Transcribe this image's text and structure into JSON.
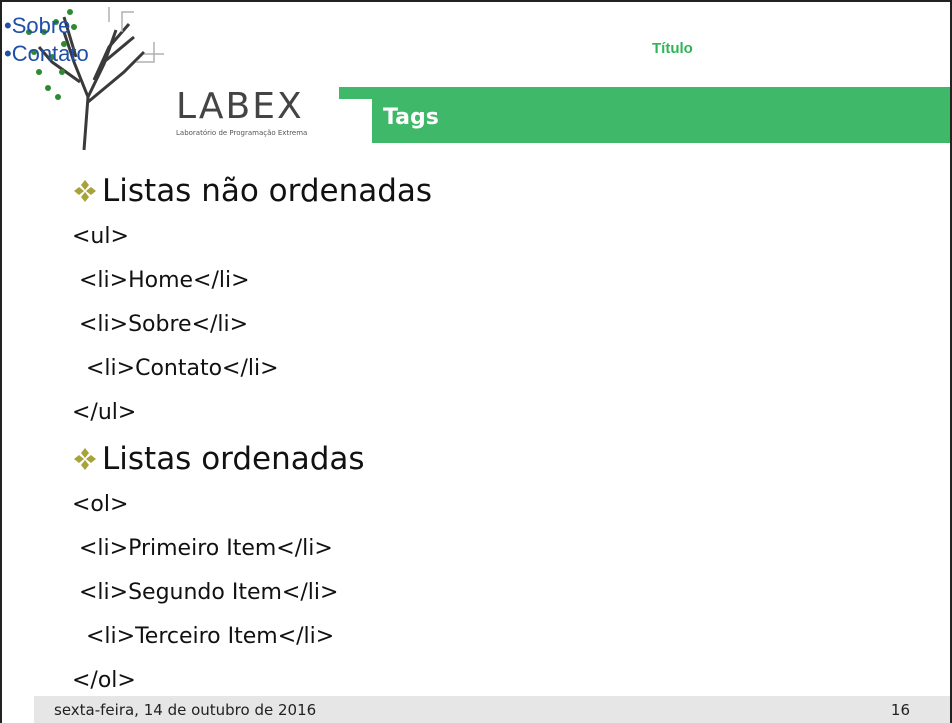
{
  "overlay_links": [
    "•Sobre",
    "•Contato"
  ],
  "logo": {
    "wordmark": "LABEX",
    "subtitle": "Laboratório de Programação Extrema"
  },
  "slide_title": "Título",
  "bar_label": "Tags",
  "sections": [
    {
      "heading": "Listas não ordenadas",
      "lines": [
        "<ul>",
        " <li>Home</li>",
        " <li>Sobre</li>",
        "  <li>Contato</li>",
        "</ul>"
      ]
    },
    {
      "heading": "Listas ordenadas",
      "lines": [
        "<ol>",
        " <li>Primeiro Item</li>",
        " <li>Segundo Item</li>",
        "  <li>Terceiro Item</li>",
        "</ol>"
      ]
    }
  ],
  "footer": {
    "date": "sexta-feira, 14 de outubro de 2016",
    "page": "16"
  },
  "colors": {
    "accent_green": "#3fb86a",
    "title_green": "#2fb457",
    "bullet_olive": "#a8a23a",
    "footer_bg": "#e6e6e6"
  },
  "icons": {
    "bullet": "diamond-bullet-icon"
  }
}
